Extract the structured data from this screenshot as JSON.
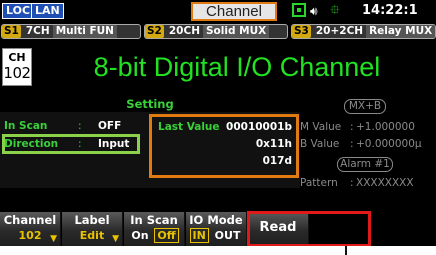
{
  "statusbar": {
    "loc": "LOC",
    "lan": "LAN",
    "title": "Channel",
    "speaker_icon": "speaker-icon",
    "usb_icon": "usb-icon",
    "time": "14:22:1"
  },
  "slots": [
    {
      "tag": "S1",
      "seg1": "7CH",
      "seg2": "Multi FUN"
    },
    {
      "tag": "S2",
      "seg1": "20CH",
      "seg2": "Solid MUX"
    },
    {
      "tag": "S3",
      "seg1": "20+2CH",
      "seg2": "Relay MUX"
    }
  ],
  "banner": {
    "ch_label": "CH",
    "ch_number": "102",
    "title": "8-bit Digital I/O Channel"
  },
  "setting": {
    "header": "Setting",
    "in_scan": {
      "label": "In Scan",
      "colon": ":",
      "value": "OFF"
    },
    "direction": {
      "label": "Direction",
      "colon": ":",
      "value": "Input"
    },
    "last_value": {
      "label": "Last Value",
      "colon": ":",
      "binary": "00010001b",
      "hex": "0x11h",
      "decimal": "017d"
    }
  },
  "right_panel": {
    "mxb": "MX+B",
    "m_value": {
      "label": "M Value",
      "colon": ":",
      "value": "+1.000000"
    },
    "b_value": {
      "label": "B Value",
      "colon": ":",
      "value": "+0.000000µ"
    },
    "alarm": "Alarm #1",
    "pattern": {
      "label": "Pattern",
      "colon": ":",
      "value": "XXXXXXXX"
    }
  },
  "softkeys": {
    "channel": {
      "title": "Channel",
      "value": "102"
    },
    "label": {
      "title": "Label",
      "value": "Edit"
    },
    "in_scan": {
      "title": "In Scan",
      "opt_on": "On",
      "opt_off": "Off"
    },
    "io_mode": {
      "title": "IO Mode",
      "opt_in": "IN",
      "opt_out": "OUT"
    },
    "read": {
      "title": "Read"
    }
  },
  "colors": {
    "accent_green": "#22e022",
    "highlight_orange": "#e07b12",
    "highlight_red": "#e01a1a",
    "highlight_lime": "#8bd14a",
    "softkey_yellow": "#e8c200"
  }
}
